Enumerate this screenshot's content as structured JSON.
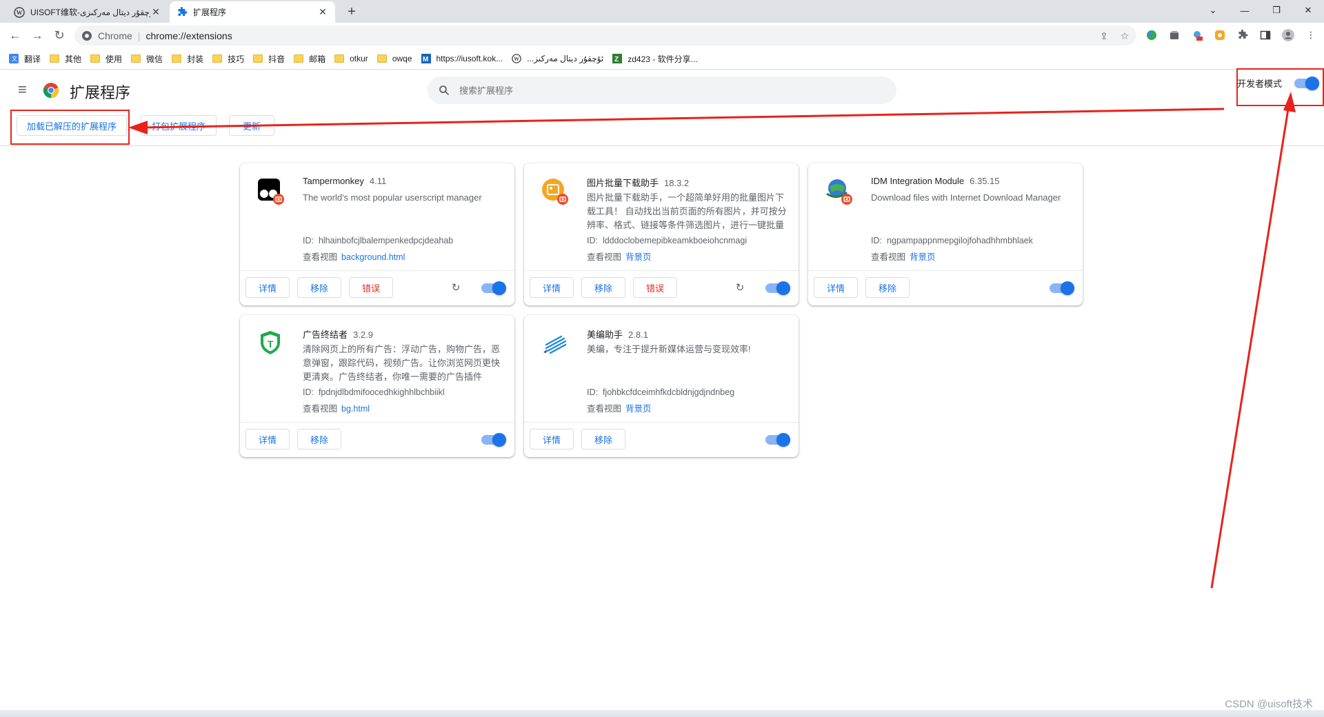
{
  "tabs": [
    {
      "title": "UISOFT维软-ئۇچقۇر ديتال مەركىزى",
      "active": false
    },
    {
      "title": "扩展程序",
      "active": true
    }
  ],
  "toolbar": {
    "url_chip": "Chrome",
    "url": "chrome://extensions"
  },
  "bookmarks": [
    {
      "label": "翻译",
      "icon": "translate-icon"
    },
    {
      "label": "其他",
      "icon": "folder-icon"
    },
    {
      "label": "使用",
      "icon": "folder-icon"
    },
    {
      "label": "微信",
      "icon": "folder-icon"
    },
    {
      "label": "封装",
      "icon": "folder-icon"
    },
    {
      "label": "技巧",
      "icon": "folder-icon"
    },
    {
      "label": "抖音",
      "icon": "folder-icon"
    },
    {
      "label": "邮箱",
      "icon": "folder-icon"
    },
    {
      "label": "otkur",
      "icon": "folder-icon"
    },
    {
      "label": "owqe",
      "icon": "folder-icon"
    },
    {
      "label": "https://iusoft.kok...",
      "icon": "site-m-icon"
    },
    {
      "label": "...ئۇچقۇر ديتال مەركىز",
      "icon": "wordpress-icon"
    },
    {
      "label": "zd423 - 软件分享...",
      "icon": "site-z-icon"
    }
  ],
  "header": {
    "title": "扩展程序",
    "search_placeholder": "搜索扩展程序",
    "dev_mode_label": "开发者模式",
    "dev_mode_on": true
  },
  "dev_actions": {
    "load_unpacked": "加载已解压的扩展程序",
    "pack": "打包扩展程序",
    "update": "更新"
  },
  "card_buttons": {
    "details": "详情",
    "remove": "移除",
    "errors": "错误"
  },
  "extensions": [
    {
      "name": "Tampermonkey",
      "version": "4.11",
      "description": "The world's most popular userscript manager",
      "id_label": "ID:",
      "id": "hlhainbofcjlbalempenkedpcjdeahab",
      "view_label": "查看视图",
      "view_link": "background.html",
      "has_error": true,
      "has_reload": true,
      "enabled": true
    },
    {
      "name": "图片批量下载助手",
      "version": "18.3.2",
      "description": "图片批量下载助手，一个超简单好用的批量图片下载工具！ 自动找出当前页面的所有图片，并可按分辨率、格式、链接等条件筛选图片，进行一键批量下载",
      "id_label": "ID:",
      "id": "ldddoclobemepibkeamkboeiohcnmagi",
      "view_label": "查看视图",
      "view_link": "背景页",
      "has_error": true,
      "has_reload": true,
      "enabled": true
    },
    {
      "name": "IDM Integration Module",
      "version": "6.35.15",
      "description": "Download files with Internet Download Manager",
      "id_label": "ID:",
      "id": "ngpampappnmepgilojfohadhhmbhlaek",
      "view_label": "查看视图",
      "view_link": "背景页",
      "has_error": false,
      "has_reload": false,
      "enabled": true
    },
    {
      "name": "广告终结者",
      "version": "3.2.9",
      "description": "清除网页上的所有广告：浮动广告，购物广告，恶意弹窗，跟踪代码，视频广告。让你浏览网页更快更清爽。广告终结者，你唯一需要的广告插件",
      "id_label": "ID:",
      "id": "fpdnjdlbdmifoocedhkighhlbchbiikl",
      "view_label": "查看视图",
      "view_link": "bg.html",
      "has_error": false,
      "has_reload": false,
      "enabled": true
    },
    {
      "name": "美编助手",
      "version": "2.8.1",
      "description": "美编，专注于提升新媒体运营与变现效率!",
      "id_label": "ID:",
      "id": "fjohbkcfdceimhfkdcbldnjgdjndnbeg",
      "view_label": "查看视图",
      "view_link": "背景页",
      "has_error": false,
      "has_reload": false,
      "enabled": true
    }
  ],
  "watermark": "CSDN @uisoft技术",
  "colors": {
    "accent": "#1a73e8",
    "annotation": "#e8221a",
    "error": "#d93025"
  }
}
